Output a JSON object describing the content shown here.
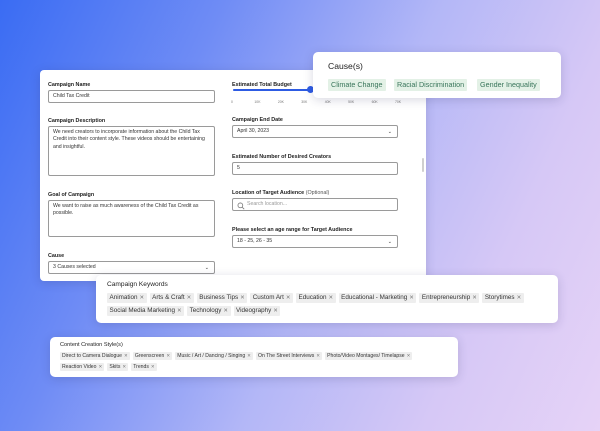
{
  "form": {
    "campaign_name": {
      "label": "Campaign Name",
      "value": "Child Tax Credit"
    },
    "campaign_description": {
      "label": "Campaign Description",
      "value": "We need creators to incorporate information about the Child Tax Credit into their content style. These videos should be entertaining and insightful."
    },
    "goal": {
      "label": "Goal of Campaign",
      "value": "We want to raise as much awareness of the Child Tax Credit as possible."
    },
    "cause": {
      "label": "Cause",
      "value": "3 Causes selected"
    },
    "budget": {
      "label": "Estimated Total Budget",
      "ticks": [
        "0",
        "10K",
        "20K",
        "30K",
        "40K",
        "50K",
        "60K",
        "70K"
      ],
      "fill_fraction": 0.47,
      "max": 70000
    },
    "end_date": {
      "label": "Campaign End Date",
      "value": "April 30, 2023"
    },
    "creators": {
      "label": "Estimated  Number of Desired Creators",
      "value": "5"
    },
    "location": {
      "label": "Location of Target Audience",
      "optional": "(Optional)",
      "placeholder": "Search location..."
    },
    "age": {
      "label": "Please select an age range for Target Audience",
      "value": "18 - 25, 26 - 35"
    }
  },
  "causes": {
    "title": "Cause(s)",
    "items": [
      "Climate Change",
      "Racial Discrimination",
      "Gender Inequality"
    ]
  },
  "keywords": {
    "title": "Campaign Keywords",
    "rows": [
      [
        "Animation",
        "Arts & Craft",
        "Business Tips",
        "Custom Art",
        "Education",
        "Educational - Marketing",
        "Entrepreneurship",
        "Storytimes"
      ],
      [
        "Social Media Marketing",
        "Technology",
        "Videography"
      ]
    ]
  },
  "content_styles": {
    "title": "Content Creation Style(s)",
    "rows": [
      [
        "Direct to Camera Dialogue",
        "Greenscreen",
        "Music / Art / Dancing / Singing",
        "On The Street Interviews",
        "Photo/Video Montages/ Timelapse"
      ],
      [
        "Reaction Video",
        "Skits",
        "Trends"
      ]
    ]
  },
  "colors": {
    "accent": "#2d5be3",
    "chip_bg": "#e3f1e6",
    "chip_text": "#38755a"
  },
  "icons": {
    "remove": "close-icon",
    "dropdown": "chevron-down-icon",
    "search": "search-icon"
  }
}
